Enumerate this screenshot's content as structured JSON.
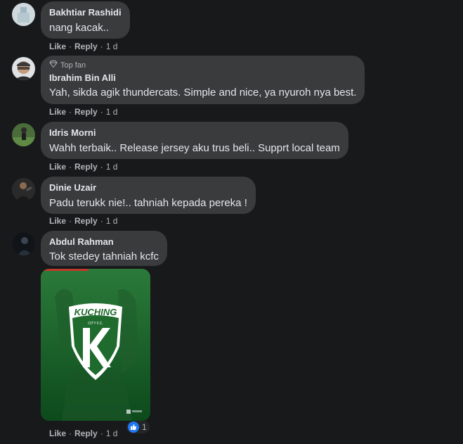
{
  "comments": [
    {
      "name": "Bakhtiar Rashidi",
      "text": "nang kacak..",
      "badge": "",
      "like": "Like",
      "reply": "Reply",
      "time": "1 d"
    },
    {
      "name": "Ibrahim Bin Alli",
      "text": "Yah, sikda agik thundercats. Simple and nice, ya nyuroh nya best.",
      "badge": "Top fan",
      "like": "Like",
      "reply": "Reply",
      "time": "1 d"
    },
    {
      "name": "Idris Morni",
      "text": "Wahh terbaik.. Release jersey aku trus beli.. Supprt local team",
      "badge": "",
      "like": "Like",
      "reply": "Reply",
      "time": "1 d"
    },
    {
      "name": "Dinie Uzair",
      "text": "Padu terukk nie!.. tahniah kepada pereka !",
      "badge": "",
      "like": "Like",
      "reply": "Reply",
      "time": "1 d"
    },
    {
      "name": "Abdul Rahman",
      "text": "Tok stedey tahniah kcfc",
      "badge": "",
      "like": "Like",
      "reply": "Reply",
      "time": "1 d",
      "image": {
        "logo_text": "KUCHING",
        "logo_sub": "CITY F.C.",
        "logo_letter": "K"
      },
      "reaction_count": "1"
    }
  ],
  "colors": {
    "background": "#18191a",
    "bubble": "#3a3b3c",
    "text": "#e4e6eb",
    "secondary_text": "#b0b3b8",
    "like_blue": "#2078f4",
    "image_green": "#1f6b2e"
  },
  "icons": {
    "top_fan": "diamond-icon",
    "reaction": "thumbs-up-icon"
  }
}
